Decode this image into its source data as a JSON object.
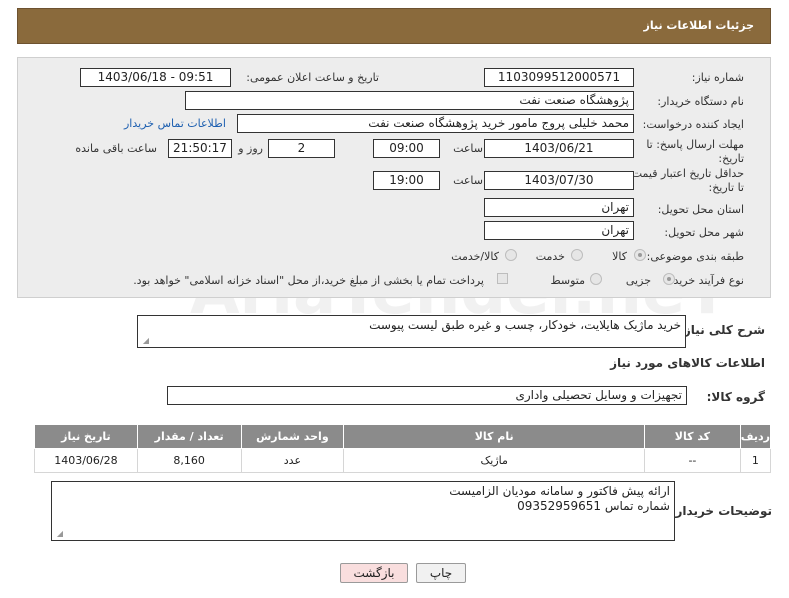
{
  "page_title": "جزئیات اطلاعات نیاز",
  "fields": {
    "need_number_label": "شماره نیاز:",
    "need_number": "1103099512000571",
    "announce_label": "تاریخ و ساعت اعلان عمومی:",
    "announce_value": "1403/06/18 - 09:51",
    "buyer_org_label": "نام دستگاه خریدار:",
    "buyer_org": "پژوهشگاه صنعت نفت",
    "creator_label": "ایجاد کننده درخواست:",
    "creator": "محمد خلیلی پروج مامور خرید پژوهشگاه صنعت نفت",
    "contact_link": "اطلاعات تماس خریدار",
    "deadline_label": "مهلت ارسال پاسخ: تا تاریخ:",
    "deadline_date": "1403/06/21",
    "time_label": "ساعت",
    "deadline_time": "09:00",
    "days_value": "2",
    "days_label": "روز و",
    "remaining_time": "21:50:17",
    "remaining_label": "ساعت باقی مانده",
    "validity_label": "حداقل تاریخ اعتبار قیمت: تا تاریخ:",
    "validity_date": "1403/07/30",
    "validity_time": "19:00",
    "province_label": "استان محل تحویل:",
    "province": "تهران",
    "city_label": "شهر محل تحویل:",
    "city": "تهران",
    "category_label": "طبقه بندی موضوعی:",
    "category_options": [
      "کالا",
      "خدمت",
      "کالا/خدمت"
    ],
    "process_label": "نوع فرآیند خرید :",
    "process_options": [
      "جزیی",
      "متوسط"
    ],
    "payment_note": "پرداخت تمام یا بخشی از مبلغ خرید،از محل \"اسناد خزانه اسلامی\" خواهد بود."
  },
  "description_label": "شرح کلی نیاز:",
  "description": "خرید ماژیک هایلایت، خودکار، چسب و غیره طبق لیست پیوست",
  "goods_info_title": "اطلاعات کالاهای مورد نیاز",
  "goods_group_label": "گروه کالا:",
  "goods_group": "تجهیزات و وسایل تحصیلی واداری",
  "table": {
    "headers": [
      "ردیف",
      "کد کالا",
      "نام کالا",
      "واحد شمارش",
      "تعداد / مقدار",
      "تاریخ نیاز"
    ],
    "rows": [
      [
        "1",
        "--",
        "ماژیک",
        "عدد",
        "8,160",
        "1403/06/28"
      ]
    ]
  },
  "buyer_notes_label": "توضیحات خریدار:",
  "buyer_notes_line1": "ارائه پیش فاکتور و سامانه مودیان الزامیست",
  "buyer_notes_line2": "شماره تماس 09352959651",
  "buttons": {
    "print": "چاپ",
    "back": "بازگشت"
  },
  "watermark": "AriaTender.neT",
  "colors": {
    "header": "#8a6a3c",
    "table_header": "#8b8b8b",
    "link": "#1d5fb0",
    "back_button": "#f9dede"
  }
}
